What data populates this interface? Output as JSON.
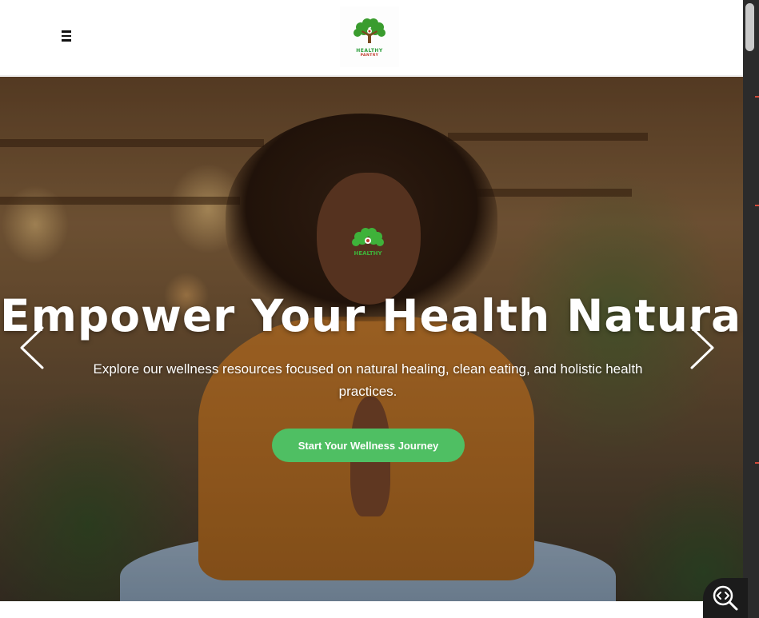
{
  "header": {
    "menu_icon": "hamburger-menu-icon",
    "logo": {
      "text_line1": "HEALTHY",
      "text_line2": "PANTRY",
      "icon": "tree-leaf-logo-icon",
      "brand_green": "#3a9c2e",
      "brand_red": "#c0392b"
    }
  },
  "hero": {
    "title": "Empower Your Health Naturally",
    "subtitle": "Explore our wellness resources focused on natural healing, clean eating, and holistic health practices.",
    "cta_label": "Start Your Wellness Journey",
    "prev_icon": "chevron-left-icon",
    "next_icon": "chevron-right-icon",
    "watermark_text": "HEALTHY",
    "colors": {
      "cta_background": "#4fbf63",
      "title_color": "#ffffff"
    }
  },
  "widgets": {
    "zoom_icon": "zoom-code-icon"
  }
}
